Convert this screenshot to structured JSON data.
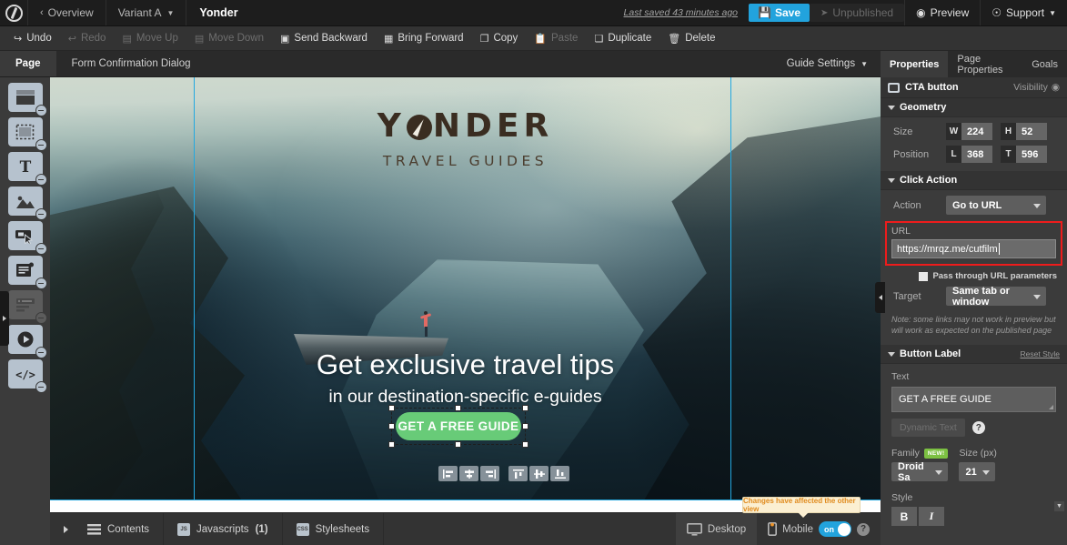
{
  "header": {
    "logo_icon": "unbounce-logo-icon",
    "overview_label": "Overview",
    "variant_label": "Variant A",
    "page_title": "Yonder",
    "last_saved": "Last saved  43 minutes ago",
    "save_label": "Save",
    "unpublished_label": "Unpublished",
    "preview_label": "Preview",
    "support_label": "Support"
  },
  "actionbar": {
    "items": [
      {
        "label": "Undo",
        "icon": "undo-arrow-icon",
        "disabled": false
      },
      {
        "label": "Redo",
        "icon": "redo-arrow-icon",
        "disabled": true
      },
      {
        "label": "Move Up",
        "icon": "move-up-icon",
        "disabled": true
      },
      {
        "label": "Move Down",
        "icon": "move-down-icon",
        "disabled": true
      },
      {
        "label": "Send Backward",
        "icon": "send-backward-icon",
        "disabled": false
      },
      {
        "label": "Bring Forward",
        "icon": "bring-forward-icon",
        "disabled": false
      },
      {
        "label": "Copy",
        "icon": "copy-icon",
        "disabled": false
      },
      {
        "label": "Paste",
        "icon": "paste-icon",
        "disabled": true
      },
      {
        "label": "Duplicate",
        "icon": "duplicate-icon",
        "disabled": false
      },
      {
        "label": "Delete",
        "icon": "trash-icon",
        "disabled": false
      }
    ]
  },
  "tabstrip": {
    "tabs": [
      {
        "label": "Page",
        "active": true
      },
      {
        "label": "Form Confirmation Dialog",
        "active": false
      }
    ],
    "guide_settings_label": "Guide Settings"
  },
  "toolrail": {
    "tools": [
      {
        "name": "section-tool",
        "icon": "section-icon",
        "dimmed": false
      },
      {
        "name": "box-tool",
        "icon": "box-icon",
        "dimmed": false
      },
      {
        "name": "text-tool",
        "icon": "text-t-icon",
        "dimmed": false
      },
      {
        "name": "image-tool",
        "icon": "image-mountain-icon",
        "dimmed": false
      },
      {
        "name": "button-tool",
        "icon": "button-cursor-icon",
        "dimmed": false
      },
      {
        "name": "form-tool",
        "icon": "form-icon",
        "dimmed": false
      },
      {
        "name": "list-tool",
        "icon": "list-icon",
        "dimmed": true
      },
      {
        "name": "video-tool",
        "icon": "video-play-icon",
        "dimmed": false
      },
      {
        "name": "code-tool",
        "icon": "code-brackets-icon",
        "dimmed": false
      }
    ]
  },
  "canvas": {
    "brand_name": "Y",
    "brand_name_rest": "NDER",
    "brand_tagline": "TRAVEL  GUIDES",
    "headline": "Get exclusive travel tips",
    "subheadline": "in our destination-specific e-guides",
    "cta_text": "GET A FREE GUIDE",
    "notification_tooltip": "Changes have affected the other view",
    "align_buttons": [
      {
        "name": "align-left-icon"
      },
      {
        "name": "align-center-icon"
      },
      {
        "name": "align-right-icon"
      },
      {
        "name": "align-top-icon"
      },
      {
        "name": "align-middle-icon"
      },
      {
        "name": "align-bottom-icon"
      }
    ]
  },
  "bottombar": {
    "contents_label": "Contents",
    "javascripts_label": "Javascripts",
    "javascripts_count": "(1)",
    "javascripts_icon_text": "JS",
    "stylesheets_label": "Stylesheets",
    "stylesheets_icon_text": "CSS",
    "desktop_label": "Desktop",
    "mobile_label": "Mobile",
    "toggle_state": "on",
    "help_label": "?"
  },
  "properties": {
    "tabs": [
      {
        "label": "Properties",
        "active": true
      },
      {
        "label": "Page Properties",
        "active": false
      },
      {
        "label": "Goals",
        "active": false
      }
    ],
    "element_name": "CTA button",
    "visibility_label": "Visibility",
    "geometry": {
      "section_title": "Geometry",
      "size_label": "Size",
      "width_key": "W",
      "width_value": "224",
      "height_key": "H",
      "height_value": "52",
      "position_label": "Position",
      "left_key": "L",
      "left_value": "368",
      "top_key": "T",
      "top_value": "596"
    },
    "click_action": {
      "section_title": "Click Action",
      "action_label": "Action",
      "action_value": "Go to URL",
      "url_label": "URL",
      "url_value": "https://mrqz.me/cutfilm",
      "pass_through_label": "Pass through URL parameters",
      "pass_through_checked": false,
      "target_label": "Target",
      "target_value": "Same tab or window",
      "note": "Note: some links may not work in preview but will work as expected on the published page",
      "highlight_color": "#ee1c1c"
    },
    "button_label": {
      "section_title": "Button Label",
      "reset_style_label": "Reset Style",
      "text_label": "Text",
      "text_value": "GET A FREE GUIDE",
      "dynamic_text_label": "Dynamic Text",
      "help_label": "?",
      "family_label": "Family",
      "family_badge": "NEW!",
      "family_value": "Droid Sa",
      "size_label": "Size (px)",
      "size_value": "21",
      "style_label": "Style",
      "bold_label": "B",
      "italic_label": "I"
    }
  },
  "colors": {
    "accent_blue": "#22a3dd",
    "cta_green": "#68cb78",
    "highlight_red": "#ee1c1c",
    "guide_blue": "#23a8e0",
    "new_badge_green": "#7cc142"
  }
}
